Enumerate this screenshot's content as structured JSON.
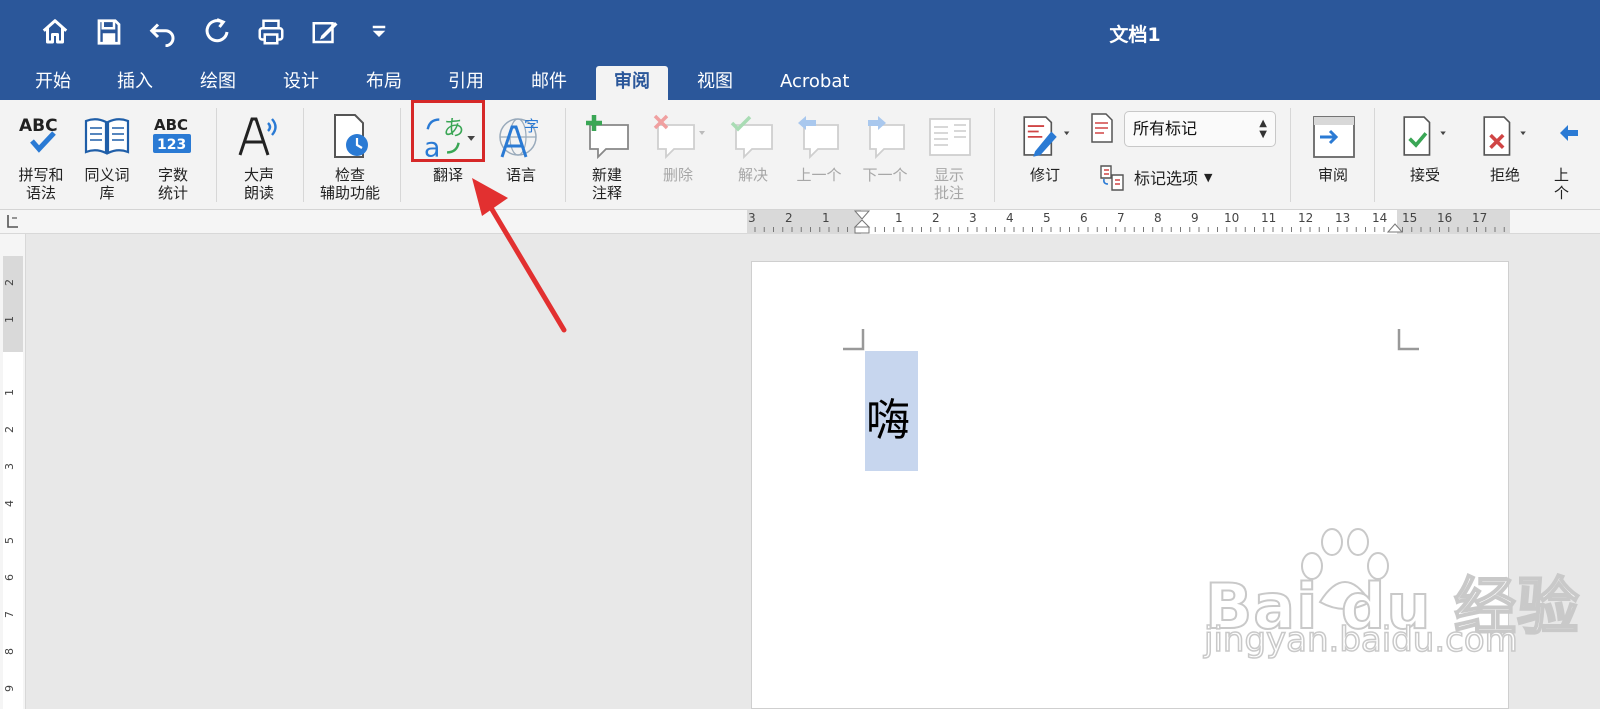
{
  "window": {
    "title": "文档1"
  },
  "tabs": [
    "开始",
    "插入",
    "绘图",
    "设计",
    "布局",
    "引用",
    "邮件",
    "审阅",
    "视图",
    "Acrobat"
  ],
  "active_tab": "审阅",
  "ribbon": {
    "spelling": "拼写和\n语法",
    "thesaurus": "同义词\n库",
    "word_count": "字数\n统计",
    "read_aloud": "大声\n朗读",
    "accessibility": "检查\n辅助功能",
    "translate": "翻译",
    "language": "语言",
    "new_comment": "新建\n注释",
    "delete": "删除",
    "resolve": "解决",
    "previous": "上一个",
    "next": "下一个",
    "show_comments": "显示\n批注",
    "track_changes": "修订",
    "markup_select": "所有标记",
    "markup_options": "标记选项",
    "review_pane": "审阅",
    "accept": "接受",
    "reject": "拒绝",
    "cut_label": "上\n个"
  },
  "icon_text": {
    "spelling": "ABC",
    "word_count_top": "ABC",
    "word_count_bottom": "123"
  },
  "ruler": {
    "h_left": [
      "3",
      "2",
      "1"
    ],
    "h_right": [
      "1",
      "2",
      "3",
      "4",
      "5",
      "6",
      "7",
      "8",
      "9",
      "10",
      "11",
      "12",
      "13",
      "14",
      "15",
      "16",
      "17"
    ],
    "v_top": [
      "2",
      "1"
    ],
    "v_bottom": [
      "1",
      "2",
      "3",
      "4",
      "5",
      "6",
      "7",
      "8",
      "9"
    ]
  },
  "document": {
    "text": "嗨"
  },
  "watermark": {
    "logo": "Bai du 经验",
    "url": "jingyan.baidu.com"
  },
  "colors": {
    "brand": "#2b579a",
    "highlight": "#d62828",
    "selection": "#c7d6ee"
  }
}
